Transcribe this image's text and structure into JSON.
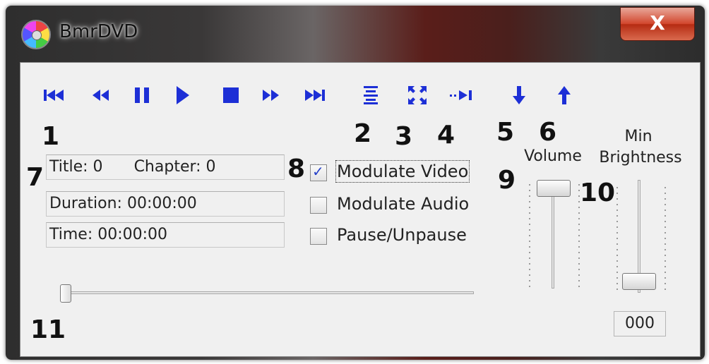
{
  "window": {
    "title": "BmrDVD",
    "close_label": "X"
  },
  "toolbar": {
    "buttons": [
      {
        "name": "skip-to-start-icon"
      },
      {
        "name": "rewind-icon"
      },
      {
        "name": "pause-icon"
      },
      {
        "name": "play-icon"
      },
      {
        "name": "stop-icon"
      },
      {
        "name": "fast-forward-icon"
      },
      {
        "name": "skip-to-end-icon"
      },
      {
        "name": "menu-list-icon"
      },
      {
        "name": "fullscreen-icon"
      },
      {
        "name": "next-frame-icon"
      },
      {
        "name": "arrow-down-icon"
      },
      {
        "name": "arrow-up-icon"
      }
    ]
  },
  "annotations": {
    "n1": "1",
    "n2": "2",
    "n3": "3",
    "n4": "4",
    "n5": "5",
    "n6": "6",
    "n7": "7",
    "n8": "8",
    "n9": "9",
    "n10": "10",
    "n11": "11"
  },
  "info": {
    "title": "Title: 0",
    "chapter": "Chapter: 0",
    "duration": "Duration: 00:00:00",
    "time": "Time: 00:00:00"
  },
  "options": {
    "modulate_video": {
      "label": "Modulate Video",
      "checked": true,
      "check_mark": "✓"
    },
    "modulate_audio": {
      "label": "Modulate Audio",
      "checked": false
    },
    "pause_unpause": {
      "label": "Pause/Unpause",
      "checked": false
    }
  },
  "volume": {
    "label": "Volume",
    "level": 1.0
  },
  "brightness": {
    "label_line1": "Min",
    "label_line2": "Brightness",
    "value": "000",
    "level": 0.0
  },
  "seek": {
    "position": 0.0
  },
  "colors": {
    "accent": "#1d2fd6",
    "close": "#c8381e"
  }
}
